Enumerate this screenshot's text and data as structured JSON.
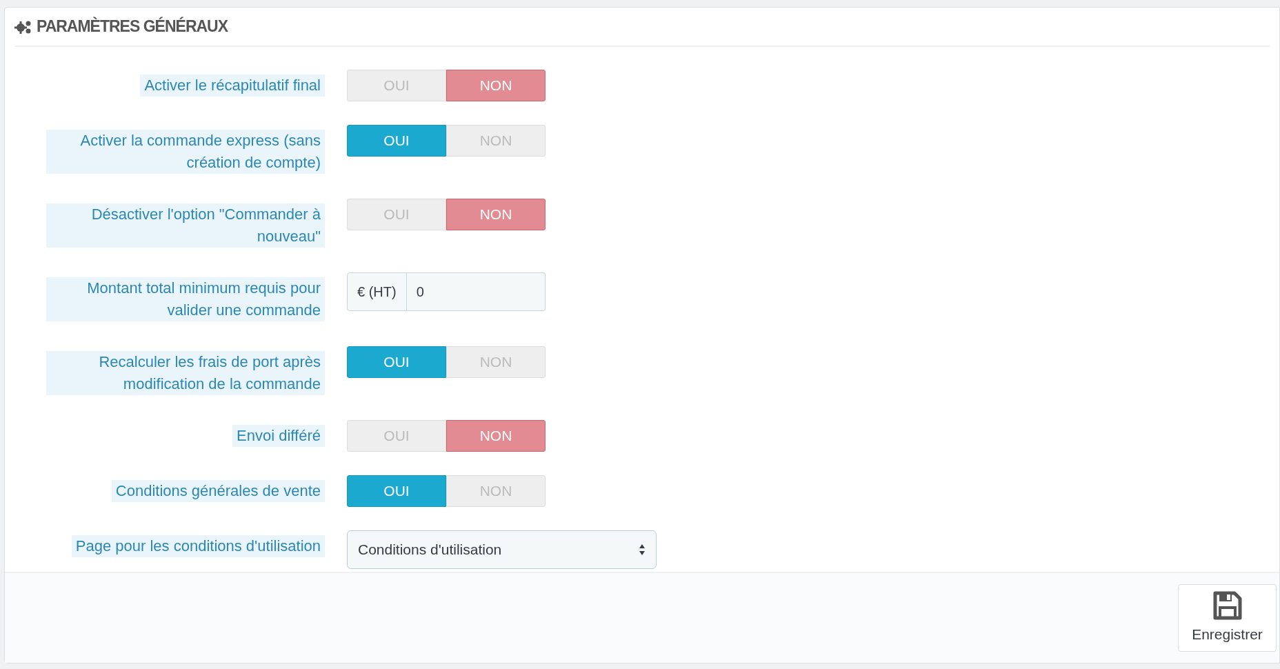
{
  "panel": {
    "title": "PARAMÈTRES GÉNÉRAUX"
  },
  "fields": [
    {
      "kind": "toggle",
      "label": "Activer le récapitulatif final",
      "options": [
        {
          "label": "OUI",
          "selected": false
        },
        {
          "label": "NON",
          "selected": true
        }
      ]
    },
    {
      "kind": "toggle",
      "label": "Activer la commande express (sans création de compte)",
      "options": [
        {
          "label": "OUI",
          "selected": true
        },
        {
          "label": "NON",
          "selected": false
        }
      ]
    },
    {
      "kind": "toggle",
      "label": "Désactiver l'option \"Commander à nouveau\"",
      "options": [
        {
          "label": "OUI",
          "selected": false
        },
        {
          "label": "NON",
          "selected": true
        }
      ]
    },
    {
      "kind": "money",
      "label": "Montant total minimum requis pour valider une commande",
      "addon": "€ (HT)",
      "value": "0"
    },
    {
      "kind": "toggle",
      "label": "Recalculer les frais de port après modification de la commande",
      "options": [
        {
          "label": "OUI",
          "selected": true
        },
        {
          "label": "NON",
          "selected": false
        }
      ]
    },
    {
      "kind": "toggle",
      "label": "Envoi différé",
      "options": [
        {
          "label": "OUI",
          "selected": false
        },
        {
          "label": "NON",
          "selected": true
        }
      ]
    },
    {
      "kind": "toggle",
      "label": "Conditions générales de vente",
      "options": [
        {
          "label": "OUI",
          "selected": true
        },
        {
          "label": "NON",
          "selected": false
        }
      ]
    },
    {
      "kind": "select",
      "label": "Page pour les conditions d'utilisation",
      "value": "Conditions d'utilisation"
    }
  ],
  "footer": {
    "save_button": "Enregistrer"
  }
}
